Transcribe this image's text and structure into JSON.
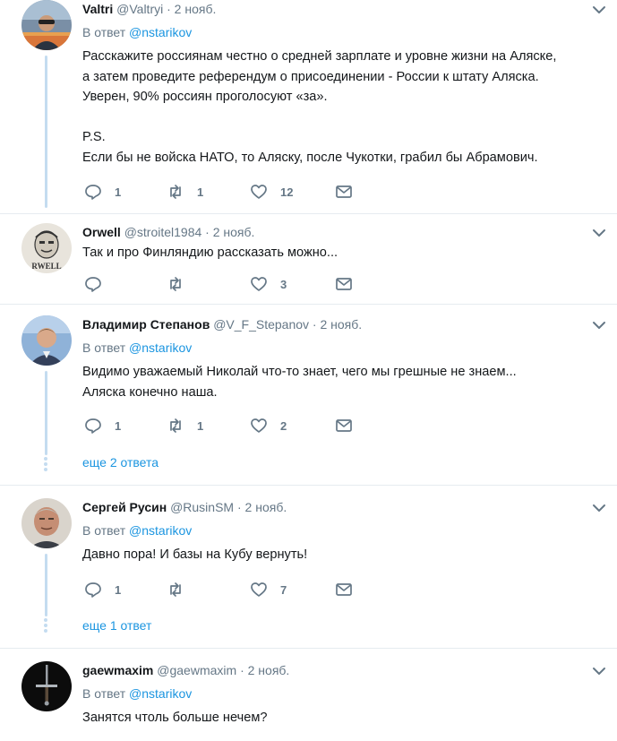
{
  "tweets": [
    {
      "name": "Valtri",
      "handle": "@Valtryi",
      "dot": "·",
      "time": "2 нояб.",
      "reply_prefix": "В ответ",
      "reply_mention": "@nstarikov",
      "text": "Расскажите россиянам честно о средней зарплате и уровне жизни на Аляске,\nа затем проведите референдум о присоединении - России к штату Аляска.\nУверен, 90% россиян проголосуют «за».\n\nP.S.\nЕсли бы не войска НАТО, то Аляску, после Чукотки, грабил бы Абрамович.",
      "replies": "1",
      "retweets": "1",
      "likes": "12"
    },
    {
      "name": "Orwell",
      "handle": "@stroitel1984",
      "dot": "·",
      "time": "2 нояб.",
      "text": "Так и про Финляндию рассказать можно...",
      "replies": "",
      "retweets": "",
      "likes": "3"
    },
    {
      "name": "Владимир Степанов",
      "handle": "@V_F_Stepanov",
      "dot": "·",
      "time": "2 нояб.",
      "reply_prefix": "В ответ",
      "reply_mention": "@nstarikov",
      "text": "Видимо уважаемый Николай что-то знает, чего мы грешные не знаем...\nАляска конечно наша.",
      "replies": "1",
      "retweets": "1",
      "likes": "2",
      "more_replies": "еще 2 ответа"
    },
    {
      "name": "Сергей Русин",
      "handle": "@RusinSM",
      "dot": "·",
      "time": "2 нояб.",
      "reply_prefix": "В ответ",
      "reply_mention": "@nstarikov",
      "text": "Давно пора! И базы на Кубу вернуть!",
      "replies": "1",
      "retweets": "",
      "likes": "7",
      "more_replies": "еще 1 ответ"
    },
    {
      "name": "gaewmaxim",
      "handle": "@gaewmaxim",
      "dot": "·",
      "time": "2 нояб.",
      "reply_prefix": "В ответ",
      "reply_mention": "@nstarikov",
      "text": "Занятся чтоль больше нечем?"
    }
  ],
  "icons": {
    "reply": "reply-icon",
    "retweet": "retweet-icon",
    "like": "heart-icon",
    "dm": "envelope-icon",
    "caret": "chevron-down-icon"
  },
  "colors": {
    "link": "#1b95e0",
    "muted": "#657786",
    "text": "#14171a",
    "thread": "#c4dcf0",
    "divider": "#e6ecf0"
  }
}
